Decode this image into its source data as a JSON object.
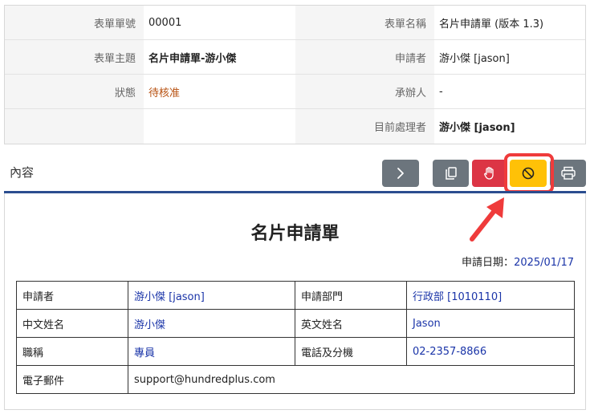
{
  "info": {
    "form_no_label": "表單單號",
    "form_no_value": "00001",
    "form_name_label": "表單名稱",
    "form_name_value": "名片申請單 (版本 1.3)",
    "subject_label": "表單主題",
    "subject_value": "名片申請單-游小傑",
    "applicant_label": "申請者",
    "applicant_value": "游小傑 [jason]",
    "status_label": "狀態",
    "status_value": "待核准",
    "handler_label": "承辦人",
    "handler_value": "-",
    "current_label": "目前處理者",
    "current_value": "游小傑 [jason]"
  },
  "section": {
    "title": "內容"
  },
  "toolbar": {
    "icons": [
      "chevron-right-icon",
      "copy-icon",
      "hand-stop-icon",
      "ban-icon",
      "printer-icon"
    ],
    "colors": {
      "secondary": "#6c757d",
      "danger": "#dc3545",
      "warning": "#ffc107",
      "highlight": "#ef3b3b"
    }
  },
  "form": {
    "title": "名片申請單",
    "apply_date_label": "申請日期：",
    "apply_date_value": "2025/01/17",
    "rows": [
      {
        "k1": "申請者",
        "v1": "游小傑 [jason]",
        "k2": "申請部門",
        "v2": "行政部 [1010110]"
      },
      {
        "k1": "中文姓名",
        "v1": "游小傑",
        "k2": "英文姓名",
        "v2": "Jason"
      },
      {
        "k1": "職稱",
        "v1": "專員",
        "k2": "電話及分機",
        "v2": "02-2357-8866"
      }
    ],
    "email_label": "電子郵件",
    "email_value": "support@hundredplus.com"
  }
}
